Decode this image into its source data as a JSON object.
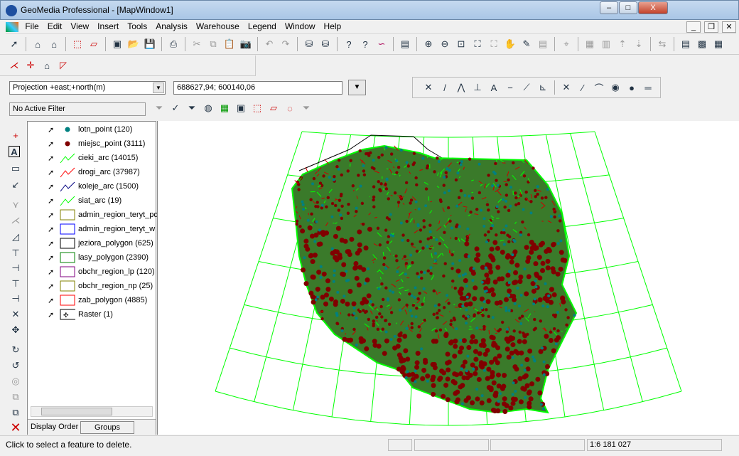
{
  "window": {
    "title": "GeoMedia Professional - [MapWindow1]",
    "minimize": "–",
    "maximize": "□",
    "close": "X"
  },
  "mdi": {
    "minimize": "_",
    "restore": "❐",
    "close": "✕"
  },
  "menu": [
    "File",
    "Edit",
    "View",
    "Insert",
    "Tools",
    "Analysis",
    "Warehouse",
    "Legend",
    "Window",
    "Help"
  ],
  "coordinates": {
    "system": "Projection +east;+north(m)",
    "value": "688627,94; 600140,06"
  },
  "filter": {
    "value": "No Active Filter"
  },
  "legend": {
    "items": [
      {
        "label": "lotn_point (120)",
        "type": "point",
        "color": "#008080"
      },
      {
        "label": "miejsc_point (3111)",
        "type": "point",
        "color": "#800000"
      },
      {
        "label": "cieki_arc (14015)",
        "type": "line",
        "color": "#00ff00"
      },
      {
        "label": "drogi_arc (37987)",
        "type": "line",
        "color": "#ff0000"
      },
      {
        "label": "koleje_arc (1500)",
        "type": "line",
        "color": "#000080"
      },
      {
        "label": "siat_arc (19)",
        "type": "line",
        "color": "#00ff00"
      },
      {
        "label": "admin_region_teryt_po",
        "type": "area",
        "color": "#808000"
      },
      {
        "label": "admin_region_teryt_w",
        "type": "area",
        "color": "#0000ff"
      },
      {
        "label": "jeziora_polygon (625)",
        "type": "area",
        "color": "#000000"
      },
      {
        "label": "lasy_polygon (2390)",
        "type": "area",
        "color": "#008000"
      },
      {
        "label": "obchr_region_lp (120)",
        "type": "area",
        "color": "#800080"
      },
      {
        "label": "obchr_region_np (25)",
        "type": "area",
        "color": "#808000"
      },
      {
        "label": "zab_polygon (4885)",
        "type": "area",
        "color": "#ff0000"
      },
      {
        "label": "Raster (1)",
        "type": "raster",
        "color": "#000000"
      }
    ],
    "tabs": [
      "Display Order",
      "Groups"
    ]
  },
  "status": {
    "message": "Click to select a feature to delete.",
    "scale": "1:6 181 027"
  },
  "colors": {
    "graticule": "#00ff00",
    "settlement": "#800000",
    "rivers": "#00ff00",
    "roads": "#cc0000",
    "airports": "#008080",
    "border": "#000000"
  }
}
